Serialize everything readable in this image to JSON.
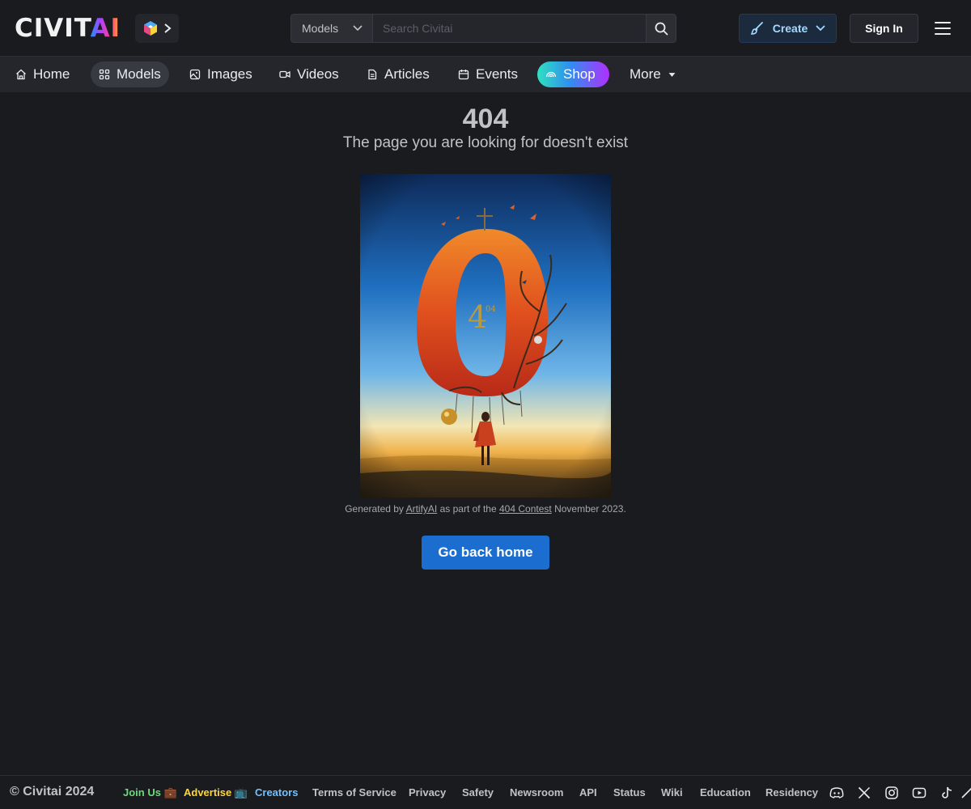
{
  "header": {
    "logo_part1": "CIVIT",
    "logo_part2": "AI",
    "search_scope": "Models",
    "search_placeholder": "Search Civitai",
    "search_shortcut": "/",
    "create_label": "Create",
    "signin_label": "Sign In"
  },
  "nav": {
    "tabs": [
      {
        "label": "Home",
        "icon": "home-icon"
      },
      {
        "label": "Models",
        "icon": "grid-icon",
        "active": true
      },
      {
        "label": "Images",
        "icon": "photo-icon"
      },
      {
        "label": "Videos",
        "icon": "video-icon"
      },
      {
        "label": "Articles",
        "icon": "file-text-icon"
      },
      {
        "label": "Events",
        "icon": "calendar-icon"
      },
      {
        "label": "Shop",
        "icon": "rainbow-icon"
      },
      {
        "label": "More",
        "icon": "caret-down-icon"
      }
    ]
  },
  "main": {
    "title": "404",
    "subtitle": "The page you are looking for doesn't exist",
    "caption_prefix": "Generated by",
    "caption_author": "ArtifyAI",
    "caption_middle": "as part of the",
    "caption_contest": "404 Contest",
    "caption_suffix": "November 2023.",
    "art_number": "4",
    "art_superscript": "04",
    "button_label": "Go back home"
  },
  "footer": {
    "copyright": "© Civitai 2024",
    "links": [
      {
        "label": "Join Us 💼",
        "color": "#69db7c"
      },
      {
        "label": "Advertise 📺",
        "color": "#ffd43b"
      },
      {
        "label": "Creators",
        "color": "#74c0fc"
      },
      {
        "label": "Terms of Service"
      },
      {
        "label": "Privacy"
      },
      {
        "label": "Safety"
      },
      {
        "label": "Newsroom"
      },
      {
        "label": "API"
      },
      {
        "label": "Status"
      },
      {
        "label": "Wiki"
      },
      {
        "label": "Education"
      },
      {
        "label": "Residency"
      }
    ],
    "social_icons": [
      "discord-icon",
      "x-icon",
      "instagram-icon",
      "youtube-icon",
      "tiktok-icon",
      "reddit-icon"
    ]
  },
  "colors": {
    "background": "#1a1b1e",
    "nav_background": "#25262b",
    "primary_button": "#1c6dd0",
    "create_text": "#a5d8ff"
  }
}
